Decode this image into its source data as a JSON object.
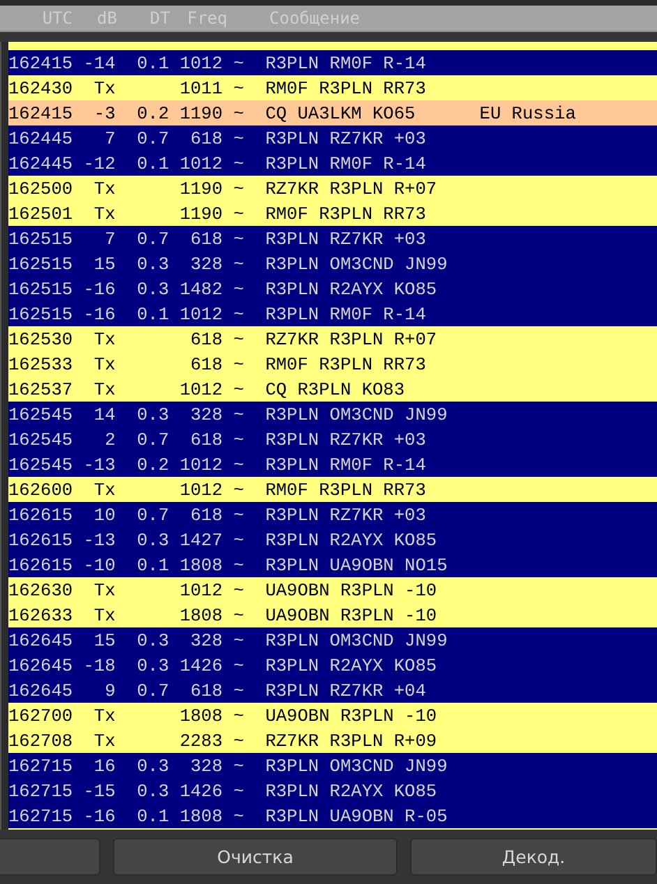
{
  "header": [
    "UTC",
    "dB",
    "DT",
    "Freq",
    "Сообщение"
  ],
  "top_partial_row": {
    "kind": "tx"
  },
  "rows": [
    {
      "kind": "rx",
      "utc": "162415",
      "db": "-14",
      "dt": "0.1",
      "freq": "1012",
      "mode": "~",
      "message": "R3PLN RM0F R-14"
    },
    {
      "kind": "tx",
      "utc": "162430",
      "db": "Tx",
      "freq": "1011",
      "mode": "~",
      "message": "RM0F R3PLN RR73"
    },
    {
      "kind": "cq",
      "utc": "162415",
      "db": "-3",
      "dt": "0.2",
      "freq": "1190",
      "mode": "~",
      "message": "CQ UA3LKM KO65",
      "country": "EU Russia"
    },
    {
      "kind": "rx",
      "utc": "162445",
      "db": "7",
      "dt": "0.7",
      "freq": "618",
      "mode": "~",
      "message": "R3PLN RZ7KR +03"
    },
    {
      "kind": "rx",
      "utc": "162445",
      "db": "-12",
      "dt": "0.1",
      "freq": "1012",
      "mode": "~",
      "message": "R3PLN RM0F R-14"
    },
    {
      "kind": "tx",
      "utc": "162500",
      "db": "Tx",
      "freq": "1190",
      "mode": "~",
      "message": "RZ7KR R3PLN R+07"
    },
    {
      "kind": "tx",
      "utc": "162501",
      "db": "Tx",
      "freq": "1190",
      "mode": "~",
      "message": "RM0F R3PLN RR73"
    },
    {
      "kind": "rx",
      "utc": "162515",
      "db": "7",
      "dt": "0.7",
      "freq": "618",
      "mode": "~",
      "message": "R3PLN RZ7KR +03"
    },
    {
      "kind": "rx",
      "utc": "162515",
      "db": "15",
      "dt": "0.3",
      "freq": "328",
      "mode": "~",
      "message": "R3PLN OM3CND JN99"
    },
    {
      "kind": "rx",
      "utc": "162515",
      "db": "-16",
      "dt": "0.3",
      "freq": "1482",
      "mode": "~",
      "message": "R3PLN R2AYX KO85"
    },
    {
      "kind": "rx",
      "utc": "162515",
      "db": "-16",
      "dt": "0.1",
      "freq": "1012",
      "mode": "~",
      "message": "R3PLN RM0F R-14"
    },
    {
      "kind": "tx",
      "utc": "162530",
      "db": "Tx",
      "freq": "618",
      "mode": "~",
      "message": "RZ7KR R3PLN R+07"
    },
    {
      "kind": "tx",
      "utc": "162533",
      "db": "Tx",
      "freq": "618",
      "mode": "~",
      "message": "RM0F R3PLN RR73"
    },
    {
      "kind": "tx",
      "utc": "162537",
      "db": "Tx",
      "freq": "1012",
      "mode": "~",
      "message": "CQ R3PLN KO83"
    },
    {
      "kind": "rx",
      "utc": "162545",
      "db": "14",
      "dt": "0.3",
      "freq": "328",
      "mode": "~",
      "message": "R3PLN OM3CND JN99"
    },
    {
      "kind": "rx",
      "utc": "162545",
      "db": "2",
      "dt": "0.7",
      "freq": "618",
      "mode": "~",
      "message": "R3PLN RZ7KR +03"
    },
    {
      "kind": "rx",
      "utc": "162545",
      "db": "-13",
      "dt": "0.2",
      "freq": "1012",
      "mode": "~",
      "message": "R3PLN RM0F R-14"
    },
    {
      "kind": "tx",
      "utc": "162600",
      "db": "Tx",
      "freq": "1012",
      "mode": "~",
      "message": "RM0F R3PLN RR73"
    },
    {
      "kind": "rx",
      "utc": "162615",
      "db": "10",
      "dt": "0.7",
      "freq": "618",
      "mode": "~",
      "message": "R3PLN RZ7KR +03"
    },
    {
      "kind": "rx",
      "utc": "162615",
      "db": "-13",
      "dt": "0.3",
      "freq": "1427",
      "mode": "~",
      "message": "R3PLN R2AYX KO85"
    },
    {
      "kind": "rx",
      "utc": "162615",
      "db": "-10",
      "dt": "0.1",
      "freq": "1808",
      "mode": "~",
      "message": "R3PLN UA9OBN NO15"
    },
    {
      "kind": "tx",
      "utc": "162630",
      "db": "Tx",
      "freq": "1012",
      "mode": "~",
      "message": "UA9OBN R3PLN -10"
    },
    {
      "kind": "tx",
      "utc": "162633",
      "db": "Tx",
      "freq": "1808",
      "mode": "~",
      "message": "UA9OBN R3PLN -10"
    },
    {
      "kind": "rx",
      "utc": "162645",
      "db": "15",
      "dt": "0.3",
      "freq": "328",
      "mode": "~",
      "message": "R3PLN OM3CND JN99"
    },
    {
      "kind": "rx",
      "utc": "162645",
      "db": "-18",
      "dt": "0.3",
      "freq": "1426",
      "mode": "~",
      "message": "R3PLN R2AYX KO85"
    },
    {
      "kind": "rx",
      "utc": "162645",
      "db": "9",
      "dt": "0.7",
      "freq": "618",
      "mode": "~",
      "message": "R3PLN RZ7KR +04"
    },
    {
      "kind": "tx",
      "utc": "162700",
      "db": "Tx",
      "freq": "1808",
      "mode": "~",
      "message": "UA9OBN R3PLN -10"
    },
    {
      "kind": "tx",
      "utc": "162708",
      "db": "Tx",
      "freq": "2283",
      "mode": "~",
      "message": "RZ7KR R3PLN R+09"
    },
    {
      "kind": "rx",
      "utc": "162715",
      "db": "16",
      "dt": "0.3",
      "freq": "328",
      "mode": "~",
      "message": "R3PLN OM3CND JN99"
    },
    {
      "kind": "rx",
      "utc": "162715",
      "db": "-15",
      "dt": "0.3",
      "freq": "1426",
      "mode": "~",
      "message": "R3PLN R2AYX KO85"
    },
    {
      "kind": "rx",
      "utc": "162715",
      "db": "-16",
      "dt": "0.1",
      "freq": "1808",
      "mode": "~",
      "message": "R3PLN UA9OBN R-05"
    }
  ],
  "bottom_partial_row": {
    "kind": "tx"
  },
  "buttons": [
    {
      "kind": "blank"
    },
    {
      "kind": "text",
      "label": "Очистка"
    },
    {
      "kind": "text",
      "label": "Декод."
    }
  ]
}
